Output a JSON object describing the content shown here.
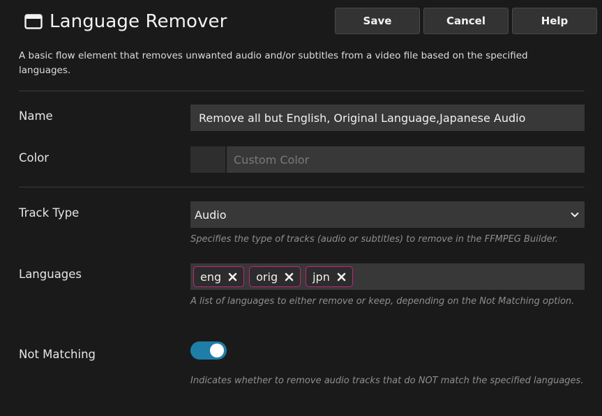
{
  "header": {
    "title": "Language Remover",
    "icon": "window-icon",
    "buttons": {
      "save": "Save",
      "cancel": "Cancel",
      "help": "Help"
    }
  },
  "description": "A basic flow element that removes unwanted audio and/or subtitles from a video file based on the specified languages.",
  "fields": {
    "name": {
      "label": "Name",
      "value": "Remove all but English, Original Language,Japanese Audio"
    },
    "color": {
      "label": "Color",
      "placeholder": "Custom Color"
    },
    "track_type": {
      "label": "Track Type",
      "value": "Audio",
      "help": "Specifies the type of tracks (audio or subtitles) to remove in the FFMPEG Builder."
    },
    "languages": {
      "label": "Languages",
      "tags": [
        "eng",
        "orig",
        "jpn"
      ],
      "help": "A list of languages to either remove or keep, depending on the Not Matching option."
    },
    "not_matching": {
      "label": "Not Matching",
      "enabled": true,
      "help": "Indicates whether to remove audio tracks that do NOT match the specified languages."
    }
  },
  "colors": {
    "background": "#1a1a1a",
    "input_bg": "#383838",
    "tag_border": "#c0267a",
    "toggle_on": "#1e7ea8"
  }
}
